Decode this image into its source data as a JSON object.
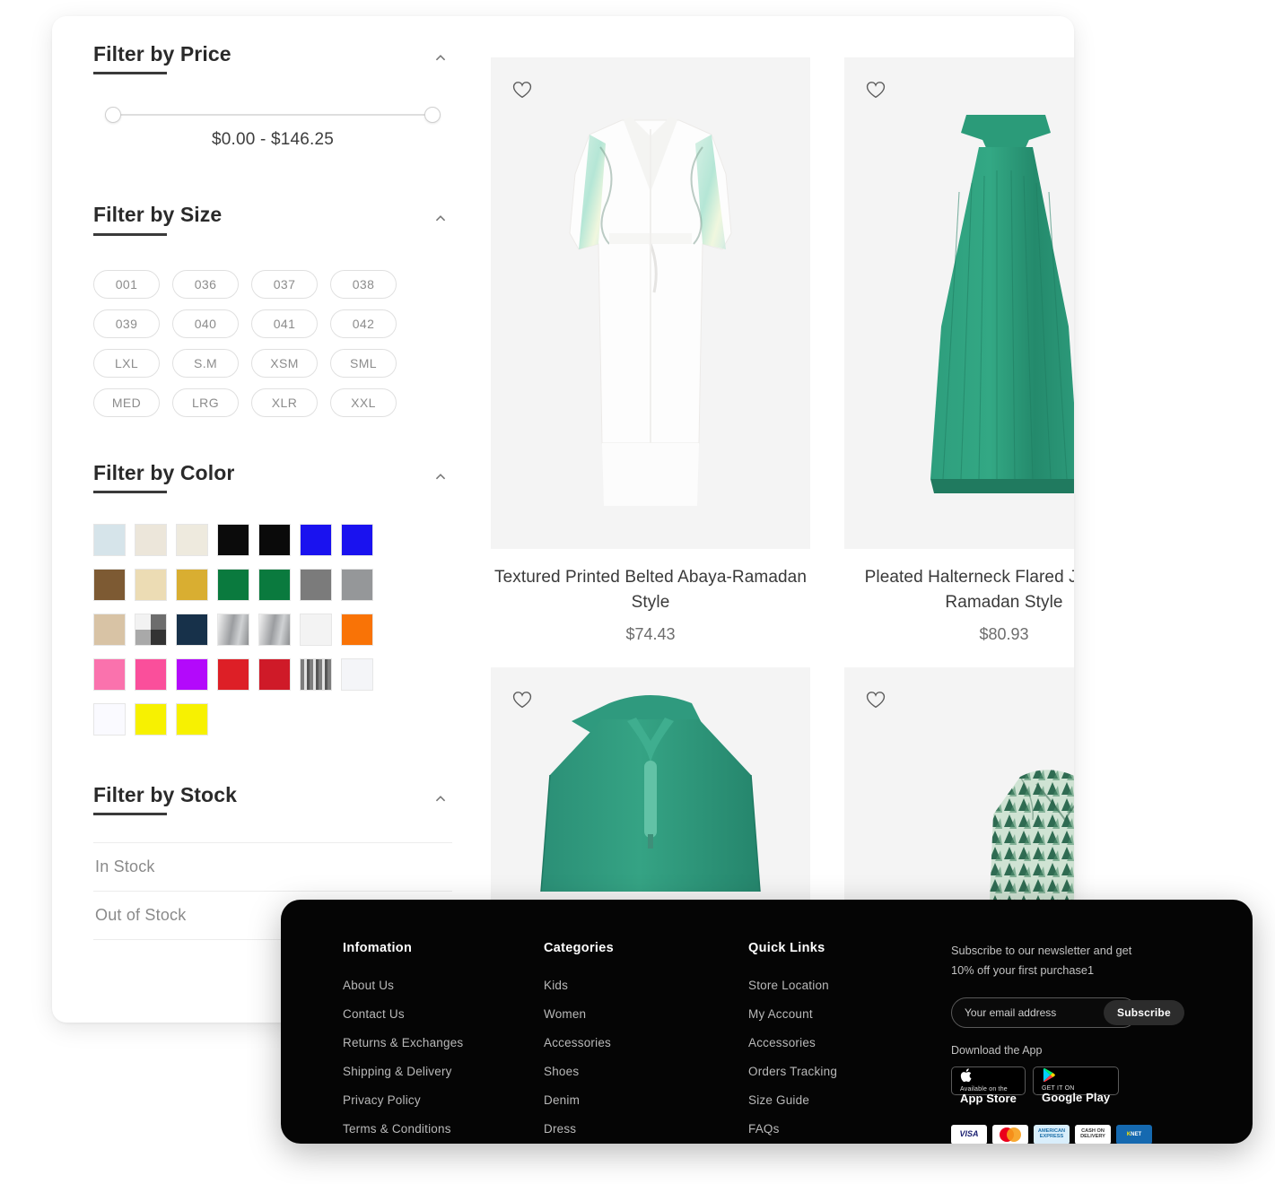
{
  "filters": {
    "price": {
      "title": "Filter by Price",
      "range_label": "$0.00 - $146.25",
      "min_label": "$0.00",
      "max_label": "$146.25",
      "collapse_icon": "chevron-up-icon"
    },
    "size": {
      "title": "Filter by Size",
      "options": [
        "001",
        "036",
        "037",
        "038",
        "039",
        "040",
        "041",
        "042",
        "LXL",
        "S.M",
        "XSM",
        "SML",
        "MED",
        "LRG",
        "XLR",
        "XXL"
      ]
    },
    "color": {
      "title": "Filter by Color",
      "swatches": [
        {
          "name": "light-blue",
          "hex": "#d6e4ea"
        },
        {
          "name": "cream",
          "hex": "#ece6da"
        },
        {
          "name": "ivory",
          "hex": "#eeeade"
        },
        {
          "name": "black",
          "hex": "#0b0b0b"
        },
        {
          "name": "black-2",
          "hex": "#0a0a0a"
        },
        {
          "name": "blue",
          "hex": "#1a12ef"
        },
        {
          "name": "blue-2",
          "hex": "#1a12ef"
        },
        {
          "name": "brown",
          "hex": "#7d5a33"
        },
        {
          "name": "beige",
          "hex": "#ecdcb4"
        },
        {
          "name": "gold",
          "hex": "#d9ae31"
        },
        {
          "name": "green",
          "hex": "#0a7a3e"
        },
        {
          "name": "green-2",
          "hex": "#0a7a3e"
        },
        {
          "name": "grey",
          "hex": "#7b7b7b"
        },
        {
          "name": "grey-2",
          "hex": "#959799"
        },
        {
          "name": "tan",
          "hex": "#d8c3a5"
        },
        {
          "name": "multi-check",
          "hex": "#a8a8a8"
        },
        {
          "name": "navy",
          "hex": "#17314a"
        },
        {
          "name": "silver",
          "hex": "#b9bbbd"
        },
        {
          "name": "silver-2",
          "hex": "#b9bbbd"
        },
        {
          "name": "white",
          "hex": "#f3f3f3"
        },
        {
          "name": "orange",
          "hex": "#f97306"
        },
        {
          "name": "pink",
          "hex": "#fa72ad"
        },
        {
          "name": "hot-pink",
          "hex": "#fa4f9b"
        },
        {
          "name": "magenta",
          "hex": "#b309fb"
        },
        {
          "name": "red",
          "hex": "#dd1f26"
        },
        {
          "name": "red-2",
          "hex": "#cf1a28"
        },
        {
          "name": "silver-stripe",
          "hex": "#9a9a9a"
        },
        {
          "name": "off-white",
          "hex": "#f4f5f8"
        },
        {
          "name": "white-2",
          "hex": "#fafaff"
        },
        {
          "name": "yellow",
          "hex": "#f7f101"
        },
        {
          "name": "yellow-2",
          "hex": "#f7f101"
        }
      ]
    },
    "stock": {
      "title": "Filter by Stock",
      "options": [
        "In Stock",
        "Out of Stock"
      ]
    }
  },
  "products": [
    {
      "name": "Textured Printed Belted Abaya-Ramadan Style",
      "price": "$74.43",
      "wishlist_icon": "heart-outline-icon",
      "art": "white-abaya"
    },
    {
      "name": "Pleated Halterneck Flared Jumpsuit-Ramadan Style",
      "price": "$80.93",
      "wishlist_icon": "heart-outline-icon",
      "art": "green-jumpsuit"
    },
    {
      "name": "",
      "price": "",
      "wishlist_icon": "heart-outline-icon",
      "art": "teal-hooded-top"
    },
    {
      "name": "",
      "price": "",
      "wishlist_icon": "heart-outline-icon",
      "art": "patterned-shirt"
    }
  ],
  "footer": {
    "columns": [
      {
        "heading": "Infomation",
        "links": [
          "About Us",
          "Contact Us",
          "Returns & Exchanges",
          "Shipping & Delivery",
          "Privacy Policy",
          "Terms & Conditions"
        ]
      },
      {
        "heading": "Categories",
        "links": [
          "Kids",
          "Women",
          "Accessories",
          "Shoes",
          "Denim",
          "Dress"
        ]
      },
      {
        "heading": "Quick Links",
        "links": [
          "Store Location",
          "My Account",
          "Accessories",
          "Orders Tracking",
          "Size Guide",
          "FAQs"
        ]
      }
    ],
    "newsletter": {
      "blurb": "Subscribe to our newsletter and get 10% off your first purchase1",
      "email_placeholder": "Your email address",
      "email_value": "",
      "subscribe_label": "Subscribe"
    },
    "app": {
      "download_label": "Download the App",
      "badges": [
        {
          "icon": "apple-icon",
          "small": "Available on the",
          "big": "App Store"
        },
        {
          "icon": "google-play-icon",
          "small": "GET IT ON",
          "big": "Google Play"
        }
      ]
    },
    "payments": [
      {
        "name": "visa-icon",
        "label": "VISA"
      },
      {
        "name": "mastercard-icon",
        "label": ""
      },
      {
        "name": "amex-icon",
        "label": "AMERICAN EXPRESS"
      },
      {
        "name": "cash-on-delivery-icon",
        "label": "CASH ON DELIVERY"
      },
      {
        "name": "knet-icon",
        "label": "KNET"
      }
    ]
  }
}
